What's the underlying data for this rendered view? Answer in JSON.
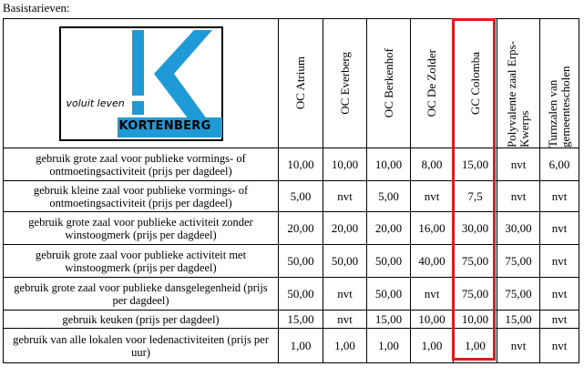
{
  "heading": "Basistarieven:",
  "logo": {
    "tagline": "voluit leven",
    "name": "KORTENBERG",
    "colors": {
      "frame": "#000000",
      "mark": "#1e9ad6"
    }
  },
  "highlight_color": "#e8171d",
  "columns": [
    "OC Atrium",
    "OC Everberg",
    "OC Berkenhof",
    "OC De Zolder",
    "GC Colomba",
    "Polyvalente zaal Erps-Kwerps",
    "Turnzalen van gemeentescholen"
  ],
  "rows": [
    {
      "label": "gebruik grote zaal voor publieke vormings- of ontmoetingsactiviteit (prijs per dagdeel)",
      "values": [
        "10,00",
        "10,00",
        "10,00",
        "8,00",
        "15,00",
        "nvt",
        "6,00"
      ]
    },
    {
      "label": "gebruik kleine zaal voor publieke vormings- of ontmoetingsactiviteit (prijs per dagdeel)",
      "values": [
        "5,00",
        "nvt",
        "5,00",
        "nvt",
        "7,5",
        "nvt",
        "nvt"
      ]
    },
    {
      "label": "gebruik grote zaal voor publieke activiteit zonder winstoogmerk (prijs per dagdeel)",
      "values": [
        "20,00",
        "20,00",
        "20,00",
        "16,00",
        "30,00",
        "30,00",
        "nvt"
      ]
    },
    {
      "label": "gebruik grote zaal voor publieke activiteit met winstoogmerk (prijs per dagdeel)",
      "values": [
        "50,00",
        "50,00",
        "50,00",
        "40,00",
        "75,00",
        "75,00",
        "nvt"
      ]
    },
    {
      "label": "gebruik grote zaal voor publieke dansgelegenheid (prijs per dagdeel)",
      "values": [
        "50,00",
        "nvt",
        "50,00",
        "nvt",
        "75,00",
        "75,00",
        "nvt"
      ]
    },
    {
      "label": "gebruik keuken (prijs per dagdeel)",
      "values": [
        "15,00",
        "nvt",
        "15,00",
        "10,00",
        "10,00",
        "15,00",
        "nvt"
      ]
    },
    {
      "label": "gebruik van alle lokalen voor ledenactiviteiten (prijs per uur)",
      "values": [
        "1,00",
        "1,00",
        "1,00",
        "1,00",
        "1,00",
        "nvt",
        "nvt"
      ]
    }
  ]
}
